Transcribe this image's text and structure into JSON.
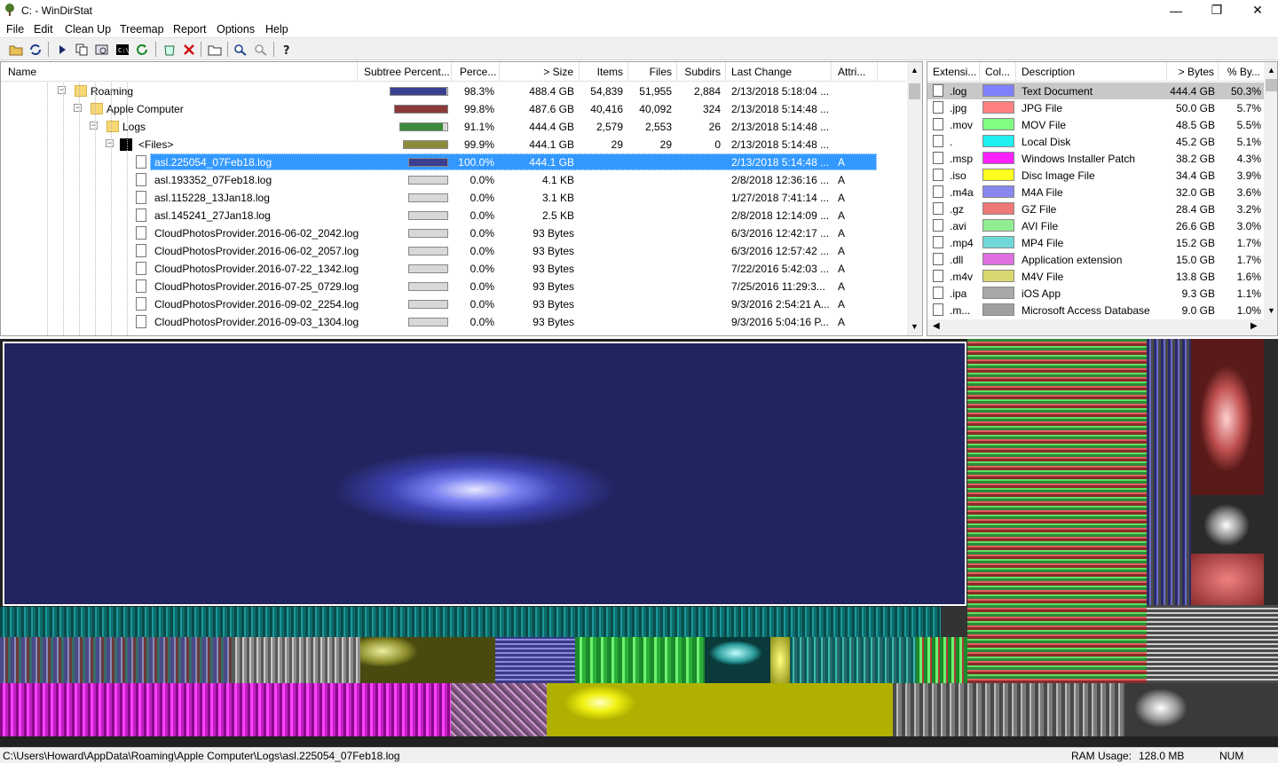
{
  "window": {
    "title": "C: - WinDirStat",
    "minimize": "—",
    "maximize": "❐",
    "close": "✕"
  },
  "menu": [
    "File",
    "Edit",
    "Clean Up",
    "Treemap",
    "Report",
    "Options",
    "Help"
  ],
  "toolbar_icons": [
    "open-icon",
    "refresh-icon",
    "play-icon",
    "copy-icon",
    "explorer-icon",
    "cmd-icon",
    "reload-icon",
    "recycle-icon",
    "delete-icon",
    "new-folder-icon",
    "zoom-in-icon",
    "zoom-out-icon",
    "help-icon"
  ],
  "tree": {
    "columns": [
      "Name",
      "Subtree Percent...",
      "Perce...",
      "> Size",
      "Items",
      "Files",
      "Subdirs",
      "Last Change",
      "Attri..."
    ],
    "rows": [
      {
        "name": "Roaming",
        "pct": "98.3%",
        "size": "488.4 GB",
        "items": "54,839",
        "files": "51,955",
        "subdirs": "2,884",
        "change": "2/13/2018  5:18:04 ...",
        "attr": "",
        "bar": 0.983,
        "color": "#3b3f8f",
        "kind": "folder",
        "level": 0
      },
      {
        "name": "Apple Computer",
        "pct": "99.8%",
        "size": "487.6 GB",
        "items": "40,416",
        "files": "40,092",
        "subdirs": "324",
        "change": "2/13/2018  5:14:48 ...",
        "attr": "",
        "bar": 0.998,
        "color": "#8b3a3a",
        "kind": "folder",
        "level": 1
      },
      {
        "name": "Logs",
        "pct": "91.1%",
        "size": "444.4 GB",
        "items": "2,579",
        "files": "2,553",
        "subdirs": "26",
        "change": "2/13/2018  5:14:48 ...",
        "attr": "",
        "bar": 0.911,
        "color": "#3b8b3b",
        "kind": "folder",
        "level": 2
      },
      {
        "name": "<Files>",
        "pct": "99.9%",
        "size": "444.1 GB",
        "items": "29",
        "files": "29",
        "subdirs": "0",
        "change": "2/13/2018  5:14:48 ...",
        "attr": "",
        "bar": 0.999,
        "color": "#8b8b3b",
        "kind": "files",
        "level": 3
      },
      {
        "name": "asl.225054_07Feb18.log",
        "pct": "100.0%",
        "size": "444.1 GB",
        "items": "",
        "files": "",
        "subdirs": "",
        "change": "2/13/2018  5:14:48 ...",
        "attr": "A",
        "bar": 1.0,
        "color": "#3b3f8f",
        "kind": "file",
        "level": 4,
        "selected": true
      },
      {
        "name": "asl.193352_07Feb18.log",
        "pct": "0.0%",
        "size": "4.1 KB",
        "items": "",
        "files": "",
        "subdirs": "",
        "change": "2/8/2018  12:36:16 ...",
        "attr": "A",
        "bar": 0,
        "color": "#3b3f8f",
        "kind": "file",
        "level": 4
      },
      {
        "name": "asl.115228_13Jan18.log",
        "pct": "0.0%",
        "size": "3.1 KB",
        "items": "",
        "files": "",
        "subdirs": "",
        "change": "1/27/2018  7:41:14 ...",
        "attr": "A",
        "bar": 0,
        "color": "#3b3f8f",
        "kind": "file",
        "level": 4
      },
      {
        "name": "asl.145241_27Jan18.log",
        "pct": "0.0%",
        "size": "2.5 KB",
        "items": "",
        "files": "",
        "subdirs": "",
        "change": "2/8/2018  12:14:09 ...",
        "attr": "A",
        "bar": 0,
        "color": "#3b3f8f",
        "kind": "file",
        "level": 4
      },
      {
        "name": "CloudPhotosProvider.2016-06-02_2042.log",
        "pct": "0.0%",
        "size": "93 Bytes",
        "items": "",
        "files": "",
        "subdirs": "",
        "change": "6/3/2016  12:42:17 ...",
        "attr": "A",
        "bar": 0,
        "color": "#3b3f8f",
        "kind": "file",
        "level": 4
      },
      {
        "name": "CloudPhotosProvider.2016-06-02_2057.log",
        "pct": "0.0%",
        "size": "93 Bytes",
        "items": "",
        "files": "",
        "subdirs": "",
        "change": "6/3/2016  12:57:42 ...",
        "attr": "A",
        "bar": 0,
        "color": "#3b3f8f",
        "kind": "file",
        "level": 4
      },
      {
        "name": "CloudPhotosProvider.2016-07-22_1342.log",
        "pct": "0.0%",
        "size": "93 Bytes",
        "items": "",
        "files": "",
        "subdirs": "",
        "change": "7/22/2016  5:42:03 ...",
        "attr": "A",
        "bar": 0,
        "color": "#3b3f8f",
        "kind": "file",
        "level": 4
      },
      {
        "name": "CloudPhotosProvider.2016-07-25_0729.log",
        "pct": "0.0%",
        "size": "93 Bytes",
        "items": "",
        "files": "",
        "subdirs": "",
        "change": "7/25/2016  11:29:3...",
        "attr": "A",
        "bar": 0,
        "color": "#3b3f8f",
        "kind": "file",
        "level": 4
      },
      {
        "name": "CloudPhotosProvider.2016-09-02_2254.log",
        "pct": "0.0%",
        "size": "93 Bytes",
        "items": "",
        "files": "",
        "subdirs": "",
        "change": "9/3/2016  2:54:21 A...",
        "attr": "A",
        "bar": 0,
        "color": "#3b3f8f",
        "kind": "file",
        "level": 4
      },
      {
        "name": "CloudPhotosProvider.2016-09-03_1304.log",
        "pct": "0.0%",
        "size": "93 Bytes",
        "items": "",
        "files": "",
        "subdirs": "",
        "change": "9/3/2016  5:04:16 P...",
        "attr": "A",
        "bar": 0,
        "color": "#3b3f8f",
        "kind": "file",
        "level": 4
      }
    ]
  },
  "extensions": {
    "columns": [
      "Extensi...",
      "Col...",
      "Description",
      "> Bytes",
      "% By..."
    ],
    "rows": [
      {
        "ext": ".log",
        "color": "#8080ff",
        "desc": "Text Document",
        "bytes": "444.4 GB",
        "pct": "50.3%",
        "selected": true
      },
      {
        "ext": ".jpg",
        "color": "#ff8080",
        "desc": "JPG File",
        "bytes": "50.0 GB",
        "pct": "5.7%"
      },
      {
        "ext": ".mov",
        "color": "#80ff80",
        "desc": "MOV File",
        "bytes": "48.5 GB",
        "pct": "5.5%"
      },
      {
        "ext": ".",
        "color": "#20f0f0",
        "desc": "Local Disk",
        "bytes": "45.2 GB",
        "pct": "5.1%"
      },
      {
        "ext": ".msp",
        "color": "#ff20ff",
        "desc": "Windows Installer Patch",
        "bytes": "38.2 GB",
        "pct": "4.3%"
      },
      {
        "ext": ".iso",
        "color": "#ffff20",
        "desc": "Disc Image File",
        "bytes": "34.4 GB",
        "pct": "3.9%"
      },
      {
        "ext": ".m4a",
        "color": "#8888ee",
        "desc": "M4A File",
        "bytes": "32.0 GB",
        "pct": "3.6%"
      },
      {
        "ext": ".gz",
        "color": "#ee7777",
        "desc": "GZ File",
        "bytes": "28.4 GB",
        "pct": "3.2%"
      },
      {
        "ext": ".avi",
        "color": "#90ee90",
        "desc": "AVI File",
        "bytes": "26.6 GB",
        "pct": "3.0%"
      },
      {
        "ext": ".mp4",
        "color": "#70d8d8",
        "desc": "MP4 File",
        "bytes": "15.2 GB",
        "pct": "1.7%"
      },
      {
        "ext": ".dll",
        "color": "#e070e0",
        "desc": "Application extension",
        "bytes": "15.0 GB",
        "pct": "1.7%"
      },
      {
        "ext": ".m4v",
        "color": "#d8d870",
        "desc": "M4V File",
        "bytes": "13.8 GB",
        "pct": "1.6%"
      },
      {
        "ext": ".ipa",
        "color": "#a8a8a8",
        "desc": "iOS App",
        "bytes": "9.3 GB",
        "pct": "1.1%"
      },
      {
        "ext": ".m...",
        "color": "#a0a0a0",
        "desc": "Microsoft Access Database",
        "bytes": "9.0 GB",
        "pct": "1.0%"
      }
    ]
  },
  "status": {
    "path": "C:\\Users\\Howard\\AppData\\Roaming\\Apple Computer\\Logs\\asl.225054_07Feb18.log",
    "ram_label": "RAM Usage:",
    "ram_value": "128.0 MB",
    "num": "NUM"
  }
}
